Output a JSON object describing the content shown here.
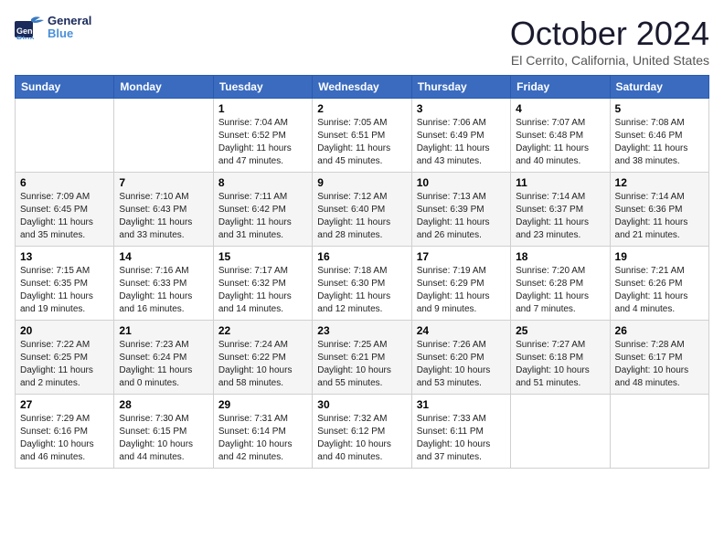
{
  "header": {
    "logo_general": "General",
    "logo_blue": "Blue",
    "month": "October 2024",
    "location": "El Cerrito, California, United States"
  },
  "days_of_week": [
    "Sunday",
    "Monday",
    "Tuesday",
    "Wednesday",
    "Thursday",
    "Friday",
    "Saturday"
  ],
  "weeks": [
    [
      {
        "day": "",
        "sunrise": "",
        "sunset": "",
        "daylight": ""
      },
      {
        "day": "",
        "sunrise": "",
        "sunset": "",
        "daylight": ""
      },
      {
        "day": "1",
        "sunrise": "Sunrise: 7:04 AM",
        "sunset": "Sunset: 6:52 PM",
        "daylight": "Daylight: 11 hours and 47 minutes."
      },
      {
        "day": "2",
        "sunrise": "Sunrise: 7:05 AM",
        "sunset": "Sunset: 6:51 PM",
        "daylight": "Daylight: 11 hours and 45 minutes."
      },
      {
        "day": "3",
        "sunrise": "Sunrise: 7:06 AM",
        "sunset": "Sunset: 6:49 PM",
        "daylight": "Daylight: 11 hours and 43 minutes."
      },
      {
        "day": "4",
        "sunrise": "Sunrise: 7:07 AM",
        "sunset": "Sunset: 6:48 PM",
        "daylight": "Daylight: 11 hours and 40 minutes."
      },
      {
        "day": "5",
        "sunrise": "Sunrise: 7:08 AM",
        "sunset": "Sunset: 6:46 PM",
        "daylight": "Daylight: 11 hours and 38 minutes."
      }
    ],
    [
      {
        "day": "6",
        "sunrise": "Sunrise: 7:09 AM",
        "sunset": "Sunset: 6:45 PM",
        "daylight": "Daylight: 11 hours and 35 minutes."
      },
      {
        "day": "7",
        "sunrise": "Sunrise: 7:10 AM",
        "sunset": "Sunset: 6:43 PM",
        "daylight": "Daylight: 11 hours and 33 minutes."
      },
      {
        "day": "8",
        "sunrise": "Sunrise: 7:11 AM",
        "sunset": "Sunset: 6:42 PM",
        "daylight": "Daylight: 11 hours and 31 minutes."
      },
      {
        "day": "9",
        "sunrise": "Sunrise: 7:12 AM",
        "sunset": "Sunset: 6:40 PM",
        "daylight": "Daylight: 11 hours and 28 minutes."
      },
      {
        "day": "10",
        "sunrise": "Sunrise: 7:13 AM",
        "sunset": "Sunset: 6:39 PM",
        "daylight": "Daylight: 11 hours and 26 minutes."
      },
      {
        "day": "11",
        "sunrise": "Sunrise: 7:14 AM",
        "sunset": "Sunset: 6:37 PM",
        "daylight": "Daylight: 11 hours and 23 minutes."
      },
      {
        "day": "12",
        "sunrise": "Sunrise: 7:14 AM",
        "sunset": "Sunset: 6:36 PM",
        "daylight": "Daylight: 11 hours and 21 minutes."
      }
    ],
    [
      {
        "day": "13",
        "sunrise": "Sunrise: 7:15 AM",
        "sunset": "Sunset: 6:35 PM",
        "daylight": "Daylight: 11 hours and 19 minutes."
      },
      {
        "day": "14",
        "sunrise": "Sunrise: 7:16 AM",
        "sunset": "Sunset: 6:33 PM",
        "daylight": "Daylight: 11 hours and 16 minutes."
      },
      {
        "day": "15",
        "sunrise": "Sunrise: 7:17 AM",
        "sunset": "Sunset: 6:32 PM",
        "daylight": "Daylight: 11 hours and 14 minutes."
      },
      {
        "day": "16",
        "sunrise": "Sunrise: 7:18 AM",
        "sunset": "Sunset: 6:30 PM",
        "daylight": "Daylight: 11 hours and 12 minutes."
      },
      {
        "day": "17",
        "sunrise": "Sunrise: 7:19 AM",
        "sunset": "Sunset: 6:29 PM",
        "daylight": "Daylight: 11 hours and 9 minutes."
      },
      {
        "day": "18",
        "sunrise": "Sunrise: 7:20 AM",
        "sunset": "Sunset: 6:28 PM",
        "daylight": "Daylight: 11 hours and 7 minutes."
      },
      {
        "day": "19",
        "sunrise": "Sunrise: 7:21 AM",
        "sunset": "Sunset: 6:26 PM",
        "daylight": "Daylight: 11 hours and 4 minutes."
      }
    ],
    [
      {
        "day": "20",
        "sunrise": "Sunrise: 7:22 AM",
        "sunset": "Sunset: 6:25 PM",
        "daylight": "Daylight: 11 hours and 2 minutes."
      },
      {
        "day": "21",
        "sunrise": "Sunrise: 7:23 AM",
        "sunset": "Sunset: 6:24 PM",
        "daylight": "Daylight: 11 hours and 0 minutes."
      },
      {
        "day": "22",
        "sunrise": "Sunrise: 7:24 AM",
        "sunset": "Sunset: 6:22 PM",
        "daylight": "Daylight: 10 hours and 58 minutes."
      },
      {
        "day": "23",
        "sunrise": "Sunrise: 7:25 AM",
        "sunset": "Sunset: 6:21 PM",
        "daylight": "Daylight: 10 hours and 55 minutes."
      },
      {
        "day": "24",
        "sunrise": "Sunrise: 7:26 AM",
        "sunset": "Sunset: 6:20 PM",
        "daylight": "Daylight: 10 hours and 53 minutes."
      },
      {
        "day": "25",
        "sunrise": "Sunrise: 7:27 AM",
        "sunset": "Sunset: 6:18 PM",
        "daylight": "Daylight: 10 hours and 51 minutes."
      },
      {
        "day": "26",
        "sunrise": "Sunrise: 7:28 AM",
        "sunset": "Sunset: 6:17 PM",
        "daylight": "Daylight: 10 hours and 48 minutes."
      }
    ],
    [
      {
        "day": "27",
        "sunrise": "Sunrise: 7:29 AM",
        "sunset": "Sunset: 6:16 PM",
        "daylight": "Daylight: 10 hours and 46 minutes."
      },
      {
        "day": "28",
        "sunrise": "Sunrise: 7:30 AM",
        "sunset": "Sunset: 6:15 PM",
        "daylight": "Daylight: 10 hours and 44 minutes."
      },
      {
        "day": "29",
        "sunrise": "Sunrise: 7:31 AM",
        "sunset": "Sunset: 6:14 PM",
        "daylight": "Daylight: 10 hours and 42 minutes."
      },
      {
        "day": "30",
        "sunrise": "Sunrise: 7:32 AM",
        "sunset": "Sunset: 6:12 PM",
        "daylight": "Daylight: 10 hours and 40 minutes."
      },
      {
        "day": "31",
        "sunrise": "Sunrise: 7:33 AM",
        "sunset": "Sunset: 6:11 PM",
        "daylight": "Daylight: 10 hours and 37 minutes."
      },
      {
        "day": "",
        "sunrise": "",
        "sunset": "",
        "daylight": ""
      },
      {
        "day": "",
        "sunrise": "",
        "sunset": "",
        "daylight": ""
      }
    ]
  ]
}
